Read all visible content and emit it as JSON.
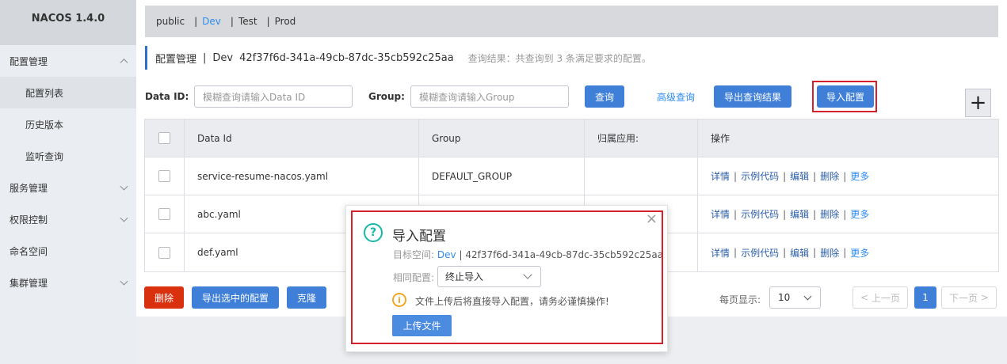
{
  "app": {
    "brand": "NACOS 1.4.0"
  },
  "sidebar": {
    "items": [
      {
        "label": "配置管理",
        "expanded": true
      },
      {
        "label": "配置列表",
        "sub": true,
        "active": true
      },
      {
        "label": "历史版本",
        "sub": true
      },
      {
        "label": "监听查询",
        "sub": true
      },
      {
        "label": "服务管理"
      },
      {
        "label": "权限控制"
      },
      {
        "label": "命名空间"
      },
      {
        "label": "集群管理"
      }
    ]
  },
  "namespaces": {
    "items": [
      "public",
      "Dev",
      "Test",
      "Prod"
    ],
    "active": "Dev"
  },
  "header": {
    "title": "配置管理",
    "separator": "|",
    "namespace": "Dev",
    "namespace_id": "42f37f6d-341a-49cb-87dc-35cb592c25aa",
    "hint": "查询结果：共查询到 3 条满足要求的配置。"
  },
  "search": {
    "dataid_label": "Data ID:",
    "dataid_placeholder": "模糊查询请输入Data ID",
    "group_label": "Group:",
    "group_placeholder": "模糊查询请输入Group",
    "query_button": "查询",
    "advanced_link": "高级查询",
    "export_button": "导出查询结果",
    "import_button": "导入配置",
    "plus": "+"
  },
  "table": {
    "headers": [
      "Data Id",
      "Group",
      "归属应用:",
      "操作"
    ],
    "rows": [
      {
        "dataid": "service-resume-nacos.yaml",
        "group": "DEFAULT_GROUP",
        "app": ""
      },
      {
        "dataid": "abc.yaml",
        "group": "",
        "app": ""
      },
      {
        "dataid": "def.yaml",
        "group": "",
        "app": ""
      }
    ],
    "ops": [
      "详情",
      "示例代码",
      "编辑",
      "删除",
      "更多"
    ]
  },
  "bottom": {
    "delete_button": "删除",
    "export_selected_button": "导出选中的配置",
    "clone_button": "克隆",
    "page_size_label": "每页显示:",
    "page_size": "10",
    "prev": "上一页",
    "current_page": "1",
    "next": "下一页"
  },
  "dialog": {
    "title": "导入配置",
    "target_label": "目标空间:",
    "target_ns": "Dev",
    "target_sep": "|",
    "target_id": "42f37f6d-341a-49cb-87dc-35cb592c25aa",
    "same_label": "相同配置:",
    "same_value": "终止导入",
    "warning": "文件上传后将直接导入配置，请务必谨慎操作!",
    "upload_button": "上传文件",
    "close": "×"
  }
}
